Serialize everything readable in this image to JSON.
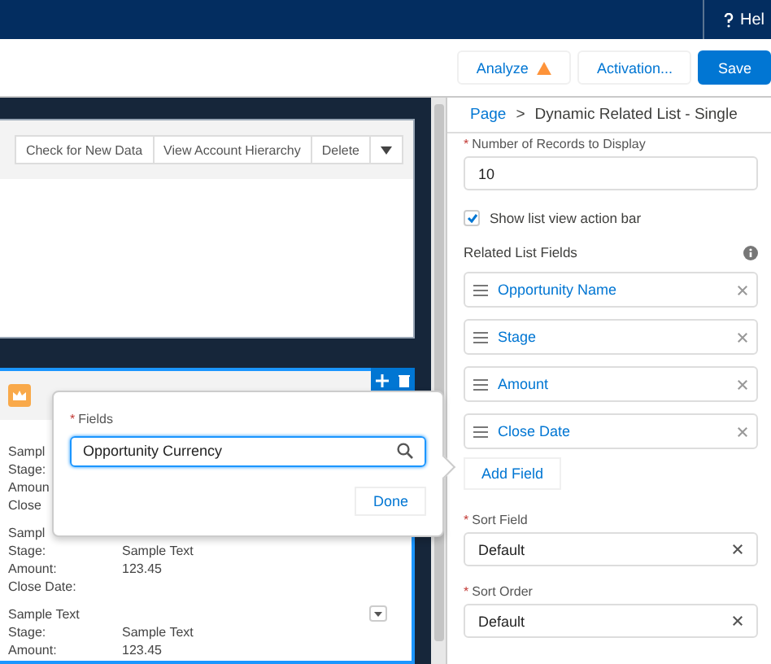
{
  "global_header": {
    "help": "Hel"
  },
  "toolbar": {
    "buttons": [
      {
        "label": "Analyze",
        "kind": "warning"
      },
      {
        "label": "Activation...",
        "kind": "neutral"
      },
      {
        "label": "Save",
        "kind": "brand"
      }
    ]
  },
  "canvas": {
    "record_actions": [
      "Check for New Data",
      "View Account Hierarchy",
      "Delete"
    ],
    "related_list": {
      "selected": true,
      "records": [
        {
          "title": "Sampl",
          "has_menu": false,
          "fields": [
            {
              "label": "Stage:"
            },
            {
              "label": "Amoun"
            },
            {
              "label": "Close"
            }
          ]
        },
        {
          "title": "Sampl",
          "has_menu": false,
          "fields": [
            {
              "label": "Stage:",
              "value": "Sample Text"
            },
            {
              "label": "Amount:",
              "value": "123.45"
            },
            {
              "label": "Close Date:"
            }
          ]
        },
        {
          "title": "Sample Text",
          "has_menu": true,
          "fields": [
            {
              "label": "Stage:",
              "value": "Sample Text"
            },
            {
              "label": "Amount:",
              "value": "123.45"
            }
          ]
        }
      ]
    }
  },
  "popover": {
    "label": "Fields",
    "required_mark": "*",
    "value": "Opportunity Currency",
    "button": "Done"
  },
  "properties": {
    "breadcrumb": [
      "Page",
      "Dynamic Related List - Single"
    ],
    "breadcrumb_separator": ">",
    "records_field": {
      "label": "Number of Records to Display",
      "required_mark": "*",
      "value": "10"
    },
    "action_bar": {
      "label": "Show list view action bar",
      "checked": true
    },
    "fields_title": "Related List Fields",
    "fields": [
      "Opportunity Name",
      "Stage",
      "Amount",
      "Close Date"
    ],
    "add_button": "Add Field",
    "sort_field": {
      "label": "Sort Field",
      "required_mark": "*",
      "value": "Default"
    },
    "sort_order": {
      "label": "Sort Order",
      "required_mark": "*",
      "value": "Default"
    }
  }
}
